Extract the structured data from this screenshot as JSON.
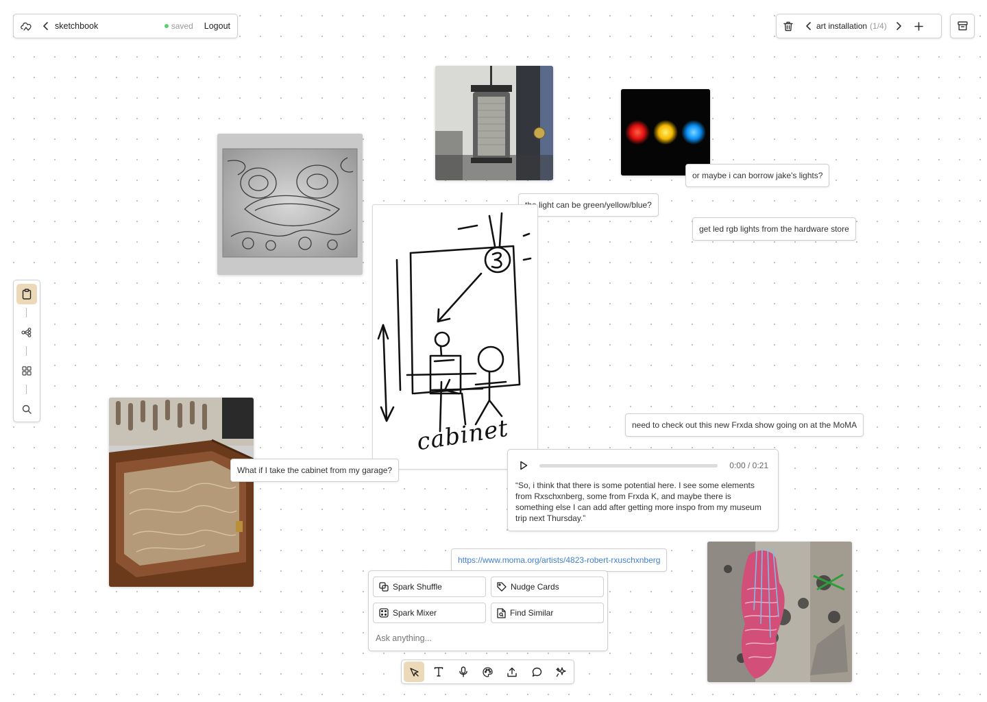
{
  "header": {
    "project": "sketchbook",
    "status": "saved",
    "logout": "Logout",
    "status_color": "#5bd16b"
  },
  "board_nav": {
    "title": "art installation",
    "counter": "(1/4)"
  },
  "notes": {
    "borrow_lights": "or maybe i can borrow jake's lights?",
    "light_colors": "the light can be green/yellow/blue?",
    "led_rgb": "get led rgb lights from the hardware store",
    "frxda_show": "need to check out this new Frxda show going on at the MoMA",
    "cabinet_question": "What if I take the cabinet from my garage?"
  },
  "sketch": {
    "caption": "cabinet"
  },
  "audio": {
    "time": "0:00 / 0:21",
    "progress": 0,
    "transcript": "“So, i think that there is some potential here. I see some elements from Rxschxnberg, some from Frxda K, and maybe there is something else I can add after getting more inspo from my museum trip next Thursday.”"
  },
  "link": {
    "url": "https://www.moma.org/artists/4823-robert-rxuschxnberg",
    "color": "#3f7fd0"
  },
  "ai_panel": {
    "spark_shuffle": "Spark Shuffle",
    "nudge_cards": "Nudge Cards",
    "spark_mixer": "Spark Mixer",
    "find_similar": "Find Similar",
    "ask_placeholder": "Ask anything..."
  },
  "accent_color": "#ecd9b8",
  "icons": {
    "logo": "cloud-hand-icon",
    "left_rail": [
      "clipboard-icon",
      "node-graph-icon",
      "grid-icon",
      "search-icon"
    ],
    "toolbar": [
      "pointer-icon",
      "text-icon",
      "microphone-icon",
      "palette-icon",
      "upload-icon",
      "comment-icon",
      "sparkle-icon"
    ]
  }
}
